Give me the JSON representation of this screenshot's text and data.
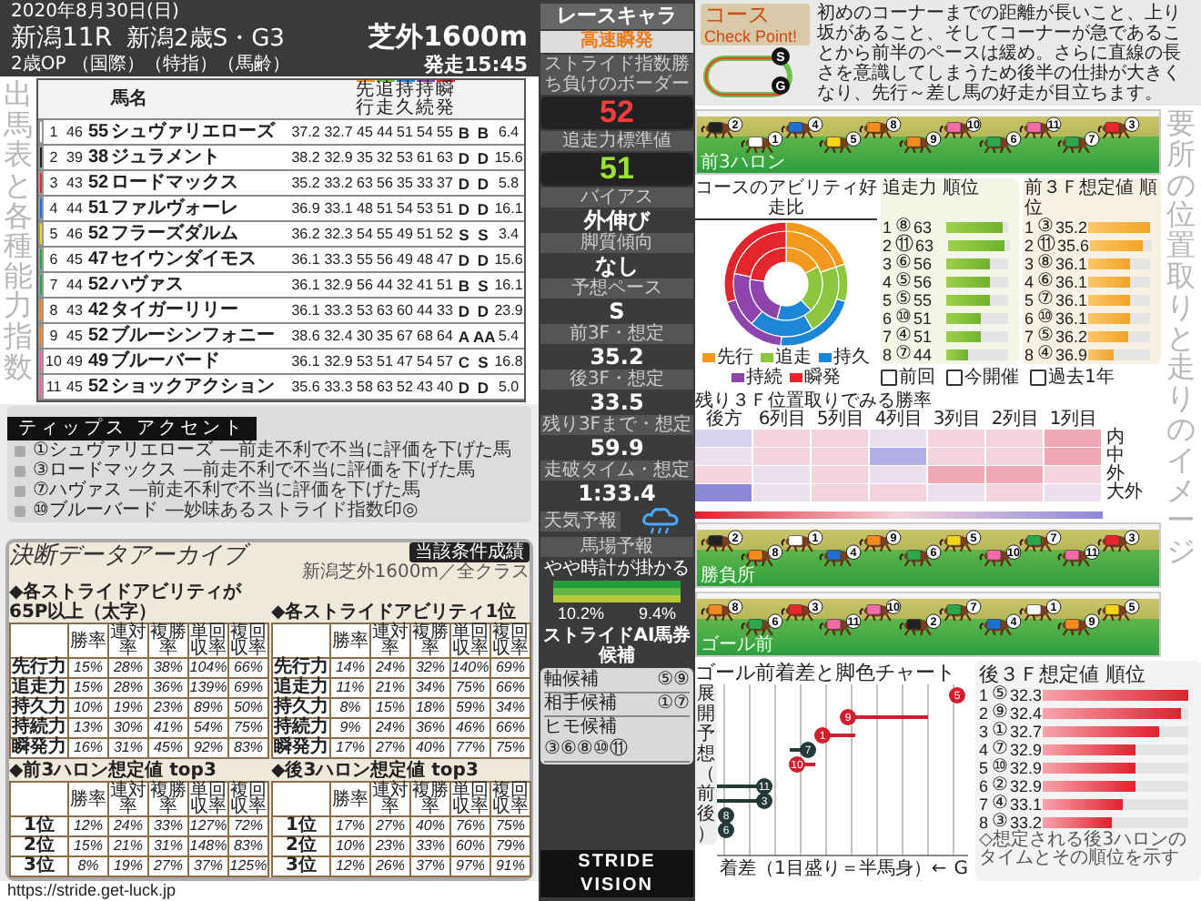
{
  "header": {
    "date": "2020年8月30日(日)",
    "race_no": "新潟11R",
    "race_name": "新潟2歳S・G3",
    "conditions": "2歳OP （国際）（特指）（馬齢）",
    "post_time": "発走15:45",
    "course": "芝外1600m"
  },
  "left_title": "出馬表と各種能力指数",
  "entry_table": {
    "name_header": "馬名",
    "ability_headers": [
      {
        "label": "先行",
        "color": "#f39a1e"
      },
      {
        "label": "追走",
        "color": "#7cc242"
      },
      {
        "label": "持久",
        "color": "#1e86d6"
      },
      {
        "label": "持続",
        "color": "#8e44ad"
      },
      {
        "label": "瞬発",
        "color": "#e3262e"
      }
    ],
    "rows": [
      {
        "color": "#ffffff",
        "no": "1",
        "index": "46",
        "rating": "55",
        "name": "シュヴァリエローズ",
        "f3": "37.2",
        "l3": "32.7",
        "abilities": [
          "45",
          "44",
          "51",
          "54",
          "55"
        ],
        "grades": [
          "B",
          "B"
        ],
        "odds": "6.4"
      },
      {
        "color": "#222222",
        "no": "2",
        "index": "39",
        "rating": "38",
        "name": "ジュラメント",
        "f3": "38.2",
        "l3": "32.9",
        "abilities": [
          "35",
          "32",
          "53",
          "61",
          "63"
        ],
        "grades": [
          "D",
          "D"
        ],
        "odds": "15.6"
      },
      {
        "color": "#e8262b",
        "no": "3",
        "index": "43",
        "rating": "52",
        "name": "ロードマックス",
        "f3": "35.2",
        "l3": "33.2",
        "abilities": [
          "63",
          "56",
          "35",
          "33",
          "37"
        ],
        "grades": [
          "D",
          "D"
        ],
        "odds": "5.8"
      },
      {
        "color": "#1f6fd1",
        "no": "4",
        "index": "44",
        "rating": "51",
        "name": "ファルヴォーレ",
        "f3": "36.9",
        "l3": "33.1",
        "abilities": [
          "48",
          "51",
          "54",
          "53",
          "51"
        ],
        "grades": [
          "D",
          "D"
        ],
        "odds": "16.1"
      },
      {
        "color": "#f5d316",
        "no": "5",
        "index": "46",
        "rating": "52",
        "name": "フラーズダルム",
        "f3": "36.2",
        "l3": "32.3",
        "abilities": [
          "54",
          "55",
          "49",
          "51",
          "52"
        ],
        "grades": [
          "S",
          "S"
        ],
        "odds": "3.4"
      },
      {
        "color": "#2aa84a",
        "no": "6",
        "index": "45",
        "rating": "47",
        "name": "セイウンダイモス",
        "f3": "36.1",
        "l3": "33.3",
        "abilities": [
          "55",
          "56",
          "49",
          "48",
          "47"
        ],
        "grades": [
          "D",
          "D"
        ],
        "odds": "15.6"
      },
      {
        "color": "#2aa84a",
        "no": "7",
        "index": "44",
        "rating": "52",
        "name": "ハヴァス",
        "f3": "36.1",
        "l3": "32.9",
        "abilities": [
          "56",
          "44",
          "32",
          "41",
          "51"
        ],
        "grades": [
          "B",
          "S"
        ],
        "odds": "16.1"
      },
      {
        "color": "#f28a1e",
        "no": "8",
        "index": "43",
        "rating": "42",
        "name": "タイガーリリー",
        "f3": "36.1",
        "l3": "33.3",
        "abilities": [
          "53",
          "63",
          "60",
          "44",
          "33"
        ],
        "grades": [
          "D",
          "D"
        ],
        "odds": "23.9"
      },
      {
        "color": "#f28a1e",
        "no": "9",
        "index": "45",
        "rating": "52",
        "name": "ブルーシンフォニー",
        "f3": "38.6",
        "l3": "32.4",
        "abilities": [
          "30",
          "35",
          "67",
          "68",
          "64"
        ],
        "grades": [
          "A",
          "AA"
        ],
        "odds": "5.4"
      },
      {
        "color": "#f06ba8",
        "no": "10",
        "index": "49",
        "rating": "49",
        "name": "ブルーバード",
        "f3": "36.1",
        "l3": "32.9",
        "abilities": [
          "53",
          "51",
          "47",
          "54",
          "57"
        ],
        "grades": [
          "C",
          "S"
        ],
        "odds": "16.8"
      },
      {
        "color": "#f06ba8",
        "no": "11",
        "index": "45",
        "rating": "52",
        "name": "ショックアクション",
        "f3": "35.6",
        "l3": "33.3",
        "abilities": [
          "58",
          "63",
          "52",
          "43",
          "40"
        ],
        "grades": [
          "D",
          "D"
        ],
        "odds": "5.0"
      }
    ]
  },
  "tips": {
    "title": "ティップス アクセント",
    "items": [
      {
        "horse": "①シュヴァリエローズ",
        "note": "―前走不利で不当に評価を下げた馬"
      },
      {
        "horse": "③ロードマックス",
        "note": "―前走不利で不当に評価を下げた馬"
      },
      {
        "horse": "⑦ハヴァス",
        "note": "―前走不利で不当に評価を下げた馬"
      },
      {
        "horse": "⑩ブルーバード",
        "note": "―妙味あるストライド指数印◎"
      }
    ]
  },
  "archive": {
    "title": "決断データアーカイブ",
    "badge": "当該条件成績",
    "subtitle": "新潟芝外1600m／全クラス",
    "tables": [
      {
        "title": "◆各ストライドアビリティが65P以上（太字）",
        "columns": [
          "勝率",
          "連対率",
          "複勝率",
          "単回収率",
          "複回収率"
        ],
        "rows": [
          {
            "label": "先行力",
            "values": [
              "15%",
              "28%",
              "38%",
              "104%",
              "66%"
            ]
          },
          {
            "label": "追走力",
            "values": [
              "15%",
              "28%",
              "36%",
              "139%",
              "69%"
            ]
          },
          {
            "label": "持久力",
            "values": [
              "10%",
              "19%",
              "23%",
              "89%",
              "50%"
            ]
          },
          {
            "label": "持続力",
            "values": [
              "13%",
              "30%",
              "41%",
              "54%",
              "75%"
            ]
          },
          {
            "label": "瞬発力",
            "values": [
              "16%",
              "31%",
              "45%",
              "92%",
              "83%"
            ]
          }
        ]
      },
      {
        "title": "◆各ストライドアビリティ1位",
        "columns": [
          "勝率",
          "連対率",
          "複勝率",
          "単回収率",
          "複回収率"
        ],
        "rows": [
          {
            "label": "先行力",
            "values": [
              "14%",
              "24%",
              "32%",
              "140%",
              "69%"
            ]
          },
          {
            "label": "追走力",
            "values": [
              "11%",
              "21%",
              "34%",
              "75%",
              "66%"
            ]
          },
          {
            "label": "持久力",
            "values": [
              "8%",
              "15%",
              "18%",
              "59%",
              "34%"
            ]
          },
          {
            "label": "持続力",
            "values": [
              "9%",
              "24%",
              "36%",
              "46%",
              "66%"
            ]
          },
          {
            "label": "瞬発力",
            "values": [
              "17%",
              "27%",
              "40%",
              "77%",
              "75%"
            ]
          }
        ]
      },
      {
        "title": "◆前3ハロン想定値 top3",
        "columns": [
          "勝率",
          "連対率",
          "複勝率",
          "単回収率",
          "複回収率"
        ],
        "rows": [
          {
            "label": "1位",
            "values": [
              "12%",
              "24%",
              "33%",
              "127%",
              "72%"
            ]
          },
          {
            "label": "2位",
            "values": [
              "15%",
              "21%",
              "31%",
              "148%",
              "83%"
            ]
          },
          {
            "label": "3位",
            "values": [
              "8%",
              "19%",
              "27%",
              "37%",
              "125%"
            ]
          }
        ]
      },
      {
        "title": "◆後3ハロン想定値 top3",
        "columns": [
          "勝率",
          "連対率",
          "複勝率",
          "単回収率",
          "複回収率"
        ],
        "rows": [
          {
            "label": "1位",
            "values": [
              "17%",
              "27%",
              "40%",
              "76%",
              "75%"
            ]
          },
          {
            "label": "2位",
            "values": [
              "10%",
              "23%",
              "33%",
              "60%",
              "79%"
            ]
          },
          {
            "label": "3位",
            "values": [
              "12%",
              "26%",
              "37%",
              "97%",
              "91%"
            ]
          }
        ]
      }
    ]
  },
  "url": "https://stride.get-luck.jp",
  "sidebar": {
    "title": "レースキャラ",
    "character": "高速瞬発",
    "metrics": [
      {
        "kind": "big",
        "label": "ストライド指数勝ち負けのボーダー",
        "value": "52",
        "color": "#ff3b3b"
      },
      {
        "kind": "big",
        "label": "追走力標準値",
        "value": "51",
        "color": "#9be22f"
      },
      {
        "kind": "plain",
        "label": "バイアス",
        "value": "外伸び"
      },
      {
        "kind": "plain",
        "label": "脚質傾向",
        "value": "なし"
      },
      {
        "kind": "plain",
        "label": "予想ペース",
        "value": "S"
      },
      {
        "kind": "plain",
        "label": "前3F・想定",
        "value": "35.2"
      },
      {
        "kind": "plain",
        "label": "後3F・想定",
        "value": "33.5"
      },
      {
        "kind": "plain",
        "label": "残り3Fまで・想定",
        "value": "59.9"
      },
      {
        "kind": "plain",
        "label": "走破タイム・想定",
        "value": "1:33.4"
      }
    ],
    "weather_label": "天気予報",
    "track_label": "馬場予報",
    "track_forecast": "やや時計が掛かる",
    "rates": [
      "10.2%",
      "9.4%"
    ],
    "ai_title": "ストライドAI馬券候補",
    "picks": [
      {
        "label": "軸候補",
        "horses": "⑤⑨"
      },
      {
        "label": "相手候補",
        "horses": "①⑦"
      },
      {
        "label": "ヒモ候補",
        "horses": "③⑥⑧⑩⑪"
      }
    ],
    "logo": "STRIDE VISION"
  },
  "checkpoint": {
    "label": "コース",
    "label_sub": "Check Point!",
    "text": "初めのコーナーまでの距離が長いこと、上り坂があること、そしてコーナーが急であることから前半のペースは緩め。さらに直線の長さを意識してしまうため後半の仕掛が大きくなり、先行～差し馬の好走が目立ちます。",
    "start_mark": "S",
    "goal_mark": "G"
  },
  "right_title": "要所の位置取りと走りのイメージ",
  "scenes": [
    {
      "label": "前3ハロン",
      "horses": [
        {
          "no": "2",
          "color": "#222222"
        },
        {
          "no": "1",
          "color": "#ffffff"
        },
        {
          "no": "4",
          "color": "#1f6fd1"
        },
        {
          "no": "5",
          "color": "#f5d316"
        },
        {
          "no": "8",
          "color": "#f28a1e"
        },
        {
          "no": "9",
          "color": "#f28a1e"
        },
        {
          "no": "10",
          "color": "#f06ba8"
        },
        {
          "no": "6",
          "color": "#2aa84a"
        },
        {
          "no": "11",
          "color": "#f06ba8"
        },
        {
          "no": "7",
          "color": "#2aa84a"
        },
        {
          "no": "3",
          "color": "#e8262b"
        }
      ]
    },
    {
      "label": "勝負所",
      "horses": [
        {
          "no": "2",
          "color": "#222222"
        },
        {
          "no": "8",
          "color": "#f28a1e"
        },
        {
          "no": "1",
          "color": "#ffffff"
        },
        {
          "no": "4",
          "color": "#1f6fd1"
        },
        {
          "no": "9",
          "color": "#f28a1e"
        },
        {
          "no": "6",
          "color": "#2aa84a"
        },
        {
          "no": "5",
          "color": "#f5d316"
        },
        {
          "no": "10",
          "color": "#f06ba8"
        },
        {
          "no": "7",
          "color": "#2aa84a"
        },
        {
          "no": "11",
          "color": "#f06ba8"
        },
        {
          "no": "3",
          "color": "#e8262b"
        }
      ]
    },
    {
      "label": "ゴール前",
      "horses": [
        {
          "no": "8",
          "color": "#f28a1e"
        },
        {
          "no": "6",
          "color": "#2aa84a"
        },
        {
          "no": "3",
          "color": "#e8262b"
        },
        {
          "no": "11",
          "color": "#f06ba8"
        },
        {
          "no": "10",
          "color": "#f06ba8"
        },
        {
          "no": "2",
          "color": "#222222"
        },
        {
          "no": "7",
          "color": "#2aa84a"
        },
        {
          "no": "4",
          "color": "#1f6fd1"
        },
        {
          "no": "1",
          "color": "#ffffff"
        },
        {
          "no": "9",
          "color": "#f28a1e"
        },
        {
          "no": "5",
          "color": "#f5d316"
        }
      ]
    }
  ],
  "ability_chart": {
    "title": "コースのアビリティ好走比",
    "chart_data": {
      "type": "donut",
      "categories": [
        "先行",
        "追走",
        "持久",
        "持続",
        "瞬発"
      ],
      "series": [
        {
          "name": "前回",
          "values": [
            17.0,
            21.0,
            16.0,
            23.0,
            23.0
          ]
        },
        {
          "name": "今開催",
          "values": [
            19.8,
            21.8,
            19.8,
            16.8,
            21.8
          ]
        },
        {
          "name": "過去1年",
          "values": [
            19.8,
            9.8,
            21.8,
            18.8,
            29.8
          ]
        }
      ],
      "colors": [
        "#f39a1e",
        "#8cc63f",
        "#1e86d6",
        "#8e44ad",
        "#e3262e"
      ]
    }
  },
  "rankings": [
    {
      "title": "追走力 順位",
      "rows": [
        {
          "rank": "1",
          "horse": "⑧",
          "value": "63",
          "level": 0.9
        },
        {
          "rank": "2",
          "horse": "⑪",
          "value": "63",
          "level": 0.9
        },
        {
          "rank": "3",
          "horse": "⑥",
          "value": "56",
          "level": 0.72
        },
        {
          "rank": "4",
          "horse": "⑤",
          "value": "56",
          "level": 0.72
        },
        {
          "rank": "5",
          "horse": "⑤",
          "value": "55",
          "level": 0.7
        },
        {
          "rank": "6",
          "horse": "⑩",
          "value": "51",
          "level": 0.55
        },
        {
          "rank": "7",
          "horse": "④",
          "value": "51",
          "level": 0.55
        },
        {
          "rank": "8",
          "horse": "⑦",
          "value": "44",
          "level": 0.35
        }
      ]
    },
    {
      "title": "前３Ｆ想定値 順位",
      "rows": [
        {
          "rank": "1",
          "horse": "③",
          "value": "35.2",
          "level": 1.0
        },
        {
          "rank": "2",
          "horse": "⑪",
          "value": "35.6",
          "level": 0.85
        },
        {
          "rank": "3",
          "horse": "⑧",
          "value": "36.1",
          "level": 0.68
        },
        {
          "rank": "4",
          "horse": "⑥",
          "value": "36.1",
          "level": 0.68
        },
        {
          "rank": "5",
          "horse": "⑦",
          "value": "36.1",
          "level": 0.68
        },
        {
          "rank": "6",
          "horse": "⑩",
          "value": "36.1",
          "level": 0.68
        },
        {
          "rank": "7",
          "horse": "⑤",
          "value": "36.2",
          "level": 0.66
        },
        {
          "rank": "8",
          "horse": "④",
          "value": "36.9",
          "level": 0.4
        }
      ]
    }
  ],
  "heatmap": {
    "title": "残り３Ｆ位置取りでみる勝率",
    "columns": [
      "後方",
      "6列目",
      "5列目",
      "4列目",
      "3列目",
      "2列目",
      "1列目"
    ],
    "rows": [
      "内",
      "中",
      "外",
      "大外"
    ]
  },
  "goal_chart": {
    "title": "ゴール前着差と脚色チャート",
    "ylabel": "展開予想（前後）",
    "xlabel": "着差（1目盛り＝半馬身）←",
    "goal": "G",
    "markers": [
      {
        "no": "5",
        "color": "#d0202e"
      },
      {
        "no": "9",
        "color": "#d0202e"
      },
      {
        "no": "1",
        "color": "#d0202e"
      },
      {
        "no": "7",
        "color": "#23393a"
      },
      {
        "no": "10",
        "color": "#d0202e"
      },
      {
        "no": "11",
        "color": "#23393a"
      },
      {
        "no": "3",
        "color": "#23393a"
      },
      {
        "no": "8",
        "color": "#23393a"
      },
      {
        "no": "6",
        "color": "#23393a"
      }
    ]
  },
  "last3f_ranking": {
    "title": "後３Ｆ想定値 順位",
    "note": "◇想定される後3ハロンのタイムとその順位を示す",
    "rows": [
      {
        "rank": "1",
        "horse": "⑤",
        "value": "32.3",
        "level": 1.0
      },
      {
        "rank": "2",
        "horse": "⑨",
        "value": "32.4",
        "level": 0.95
      },
      {
        "rank": "3",
        "horse": "①",
        "value": "32.7",
        "level": 0.8
      },
      {
        "rank": "4",
        "horse": "⑦",
        "value": "32.9",
        "level": 0.64
      },
      {
        "rank": "5",
        "horse": "⑩",
        "value": "32.9",
        "level": 0.64
      },
      {
        "rank": "6",
        "horse": "②",
        "value": "32.9",
        "level": 0.64
      },
      {
        "rank": "7",
        "horse": "④",
        "value": "33.1",
        "level": 0.55
      },
      {
        "rank": "8",
        "horse": "③",
        "value": "33.2",
        "level": 0.47
      }
    ]
  }
}
